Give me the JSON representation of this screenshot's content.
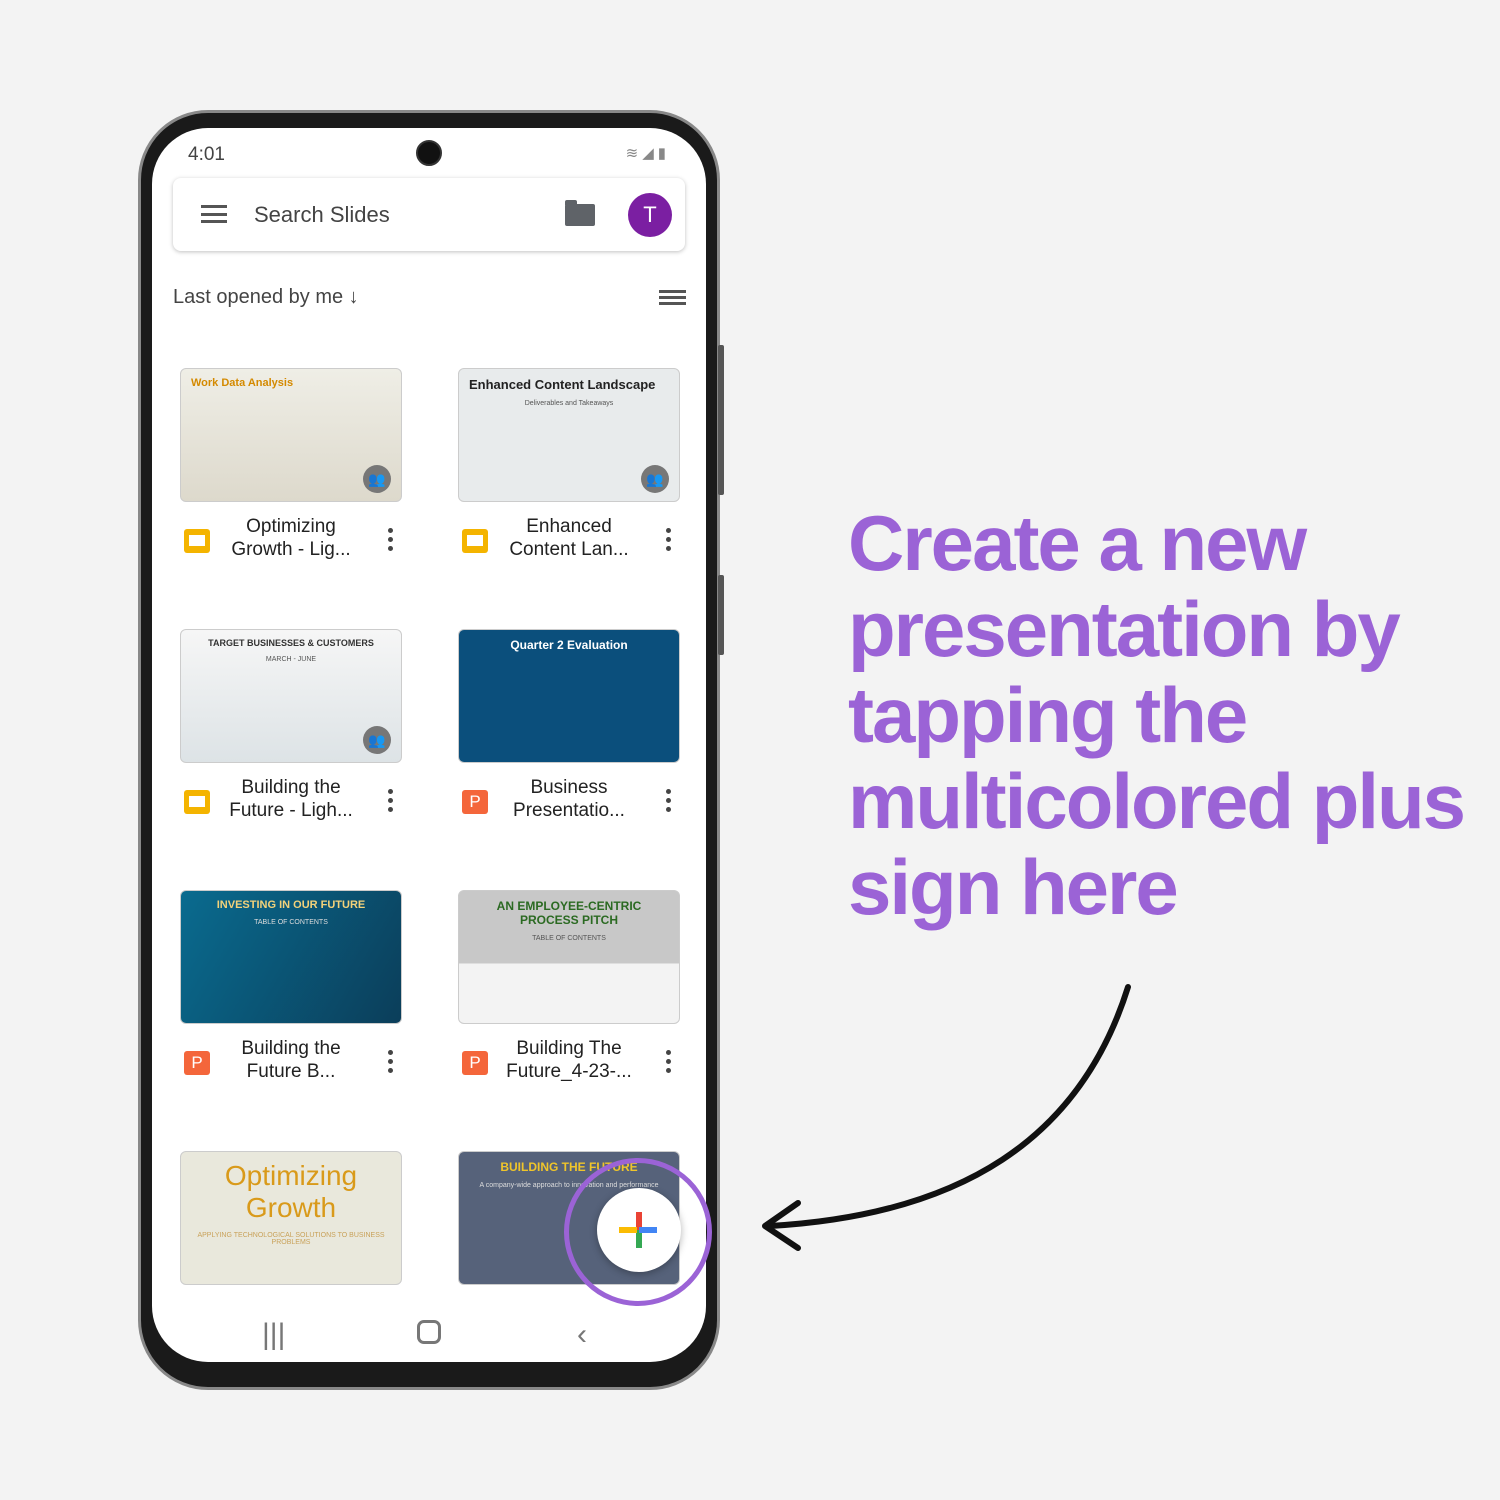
{
  "status": {
    "time": "4:01",
    "icons": [
      "wifi-icon",
      "no-signal-icon",
      "battery-icon"
    ]
  },
  "search": {
    "placeholder": "Search Slides",
    "avatar_initial": "T"
  },
  "sort": {
    "label": "Last opened by me ↓"
  },
  "files": [
    {
      "title": "Optimizing Growth - Lig...",
      "type": "slides",
      "thumb_text": "Work Data Analysis",
      "shared": true
    },
    {
      "title": "Enhanced Content Lan...",
      "type": "slides",
      "thumb_text": "Enhanced Content Landscape",
      "thumb_sub": "Deliverables and Takeaways",
      "shared": true
    },
    {
      "title": "Building the Future - Ligh...",
      "type": "slides",
      "thumb_text": "TARGET BUSINESSES & CUSTOMERS",
      "thumb_sub": "MARCH - JUNE",
      "shared": true
    },
    {
      "title": "Business Presentatio...",
      "type": "ppt",
      "thumb_text": "Quarter 2 Evaluation",
      "shared": false
    },
    {
      "title": "Building the Future B...",
      "type": "ppt",
      "thumb_text": "INVESTING IN OUR FUTURE",
      "thumb_sub": "TABLE OF CONTENTS",
      "shared": false
    },
    {
      "title": "Building The Future_4-23-...",
      "type": "ppt",
      "thumb_text": "AN EMPLOYEE-CENTRIC PROCESS PITCH",
      "thumb_sub": "TABLE OF CONTENTS",
      "shared": false
    },
    {
      "title": "",
      "type": "slides",
      "thumb_text": "Optimizing Growth",
      "thumb_sub": "APPLYING TECHNOLOGICAL SOLUTIONS TO BUSINESS PROBLEMS"
    },
    {
      "title": "",
      "type": "ppt",
      "thumb_text": "BUILDING THE FUTURE",
      "thumb_sub": "A company-wide approach to innovation and performance"
    }
  ],
  "caption": "Create a new presentation by tapping the multicolored plus sign here",
  "colors": {
    "accent": "#9b63d6",
    "avatar": "#7b1fa2"
  }
}
